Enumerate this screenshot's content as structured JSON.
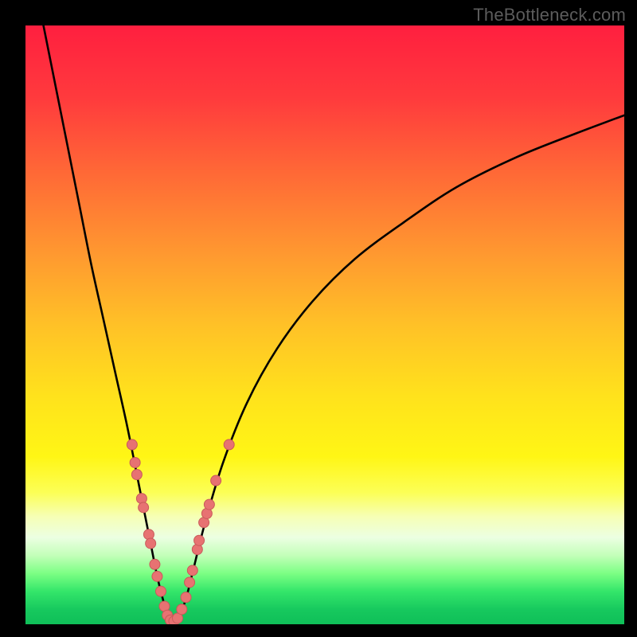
{
  "watermark": "TheBottleneck.com",
  "colors": {
    "frame": "#000000",
    "curve": "#000000",
    "marker_fill": "#e77272",
    "marker_stroke": "#c95a5a",
    "gradient_stops": [
      {
        "offset": 0.0,
        "color": "#ff1f3f"
      },
      {
        "offset": 0.12,
        "color": "#ff3a3d"
      },
      {
        "offset": 0.25,
        "color": "#ff6a36"
      },
      {
        "offset": 0.38,
        "color": "#ff9830"
      },
      {
        "offset": 0.5,
        "color": "#ffc127"
      },
      {
        "offset": 0.62,
        "color": "#ffe21c"
      },
      {
        "offset": 0.72,
        "color": "#fff615"
      },
      {
        "offset": 0.78,
        "color": "#fcff56"
      },
      {
        "offset": 0.82,
        "color": "#f6ffb5"
      },
      {
        "offset": 0.855,
        "color": "#ecffe2"
      },
      {
        "offset": 0.885,
        "color": "#c3ffb9"
      },
      {
        "offset": 0.915,
        "color": "#7cff84"
      },
      {
        "offset": 0.945,
        "color": "#34e66a"
      },
      {
        "offset": 0.975,
        "color": "#17c95e"
      },
      {
        "offset": 1.0,
        "color": "#0fbf58"
      }
    ]
  },
  "chart_data": {
    "type": "line",
    "title": "",
    "xlabel": "",
    "ylabel": "",
    "x_range": [
      0,
      100
    ],
    "y_range": [
      0,
      100
    ],
    "note": "y is bottleneck percentage (0 at bottom / green, 100 at top / red). Curve reaches 0 near x≈24 and rises on both sides.",
    "series": [
      {
        "name": "bottleneck-curve",
        "x": [
          3,
          5,
          7,
          9,
          11,
          13,
          15,
          17,
          19,
          20,
          21,
          22,
          23,
          24,
          25,
          26,
          27,
          28,
          30,
          33,
          37,
          42,
          48,
          55,
          63,
          72,
          82,
          92,
          100
        ],
        "y": [
          100,
          90,
          80,
          70,
          60,
          51,
          42,
          33,
          23,
          18,
          13,
          8,
          4,
          1,
          0.5,
          2,
          5,
          9,
          17,
          27,
          37,
          46,
          54,
          61,
          67,
          73,
          78,
          82,
          85
        ]
      }
    ],
    "markers": {
      "name": "sample-points",
      "points": [
        {
          "x": 17.8,
          "y": 30
        },
        {
          "x": 18.3,
          "y": 27
        },
        {
          "x": 18.6,
          "y": 25
        },
        {
          "x": 19.4,
          "y": 21
        },
        {
          "x": 19.7,
          "y": 19.5
        },
        {
          "x": 20.6,
          "y": 15
        },
        {
          "x": 20.9,
          "y": 13.5
        },
        {
          "x": 21.6,
          "y": 10
        },
        {
          "x": 22.0,
          "y": 8
        },
        {
          "x": 22.6,
          "y": 5.5
        },
        {
          "x": 23.2,
          "y": 3
        },
        {
          "x": 23.7,
          "y": 1.5
        },
        {
          "x": 24.2,
          "y": 0.7
        },
        {
          "x": 24.8,
          "y": 0.5
        },
        {
          "x": 25.4,
          "y": 1
        },
        {
          "x": 26.1,
          "y": 2.5
        },
        {
          "x": 26.8,
          "y": 4.5
        },
        {
          "x": 27.4,
          "y": 7
        },
        {
          "x": 27.9,
          "y": 9
        },
        {
          "x": 28.7,
          "y": 12.5
        },
        {
          "x": 29.0,
          "y": 14
        },
        {
          "x": 29.8,
          "y": 17
        },
        {
          "x": 30.3,
          "y": 18.5
        },
        {
          "x": 30.7,
          "y": 20
        },
        {
          "x": 31.8,
          "y": 24
        },
        {
          "x": 34.0,
          "y": 30
        }
      ]
    }
  }
}
